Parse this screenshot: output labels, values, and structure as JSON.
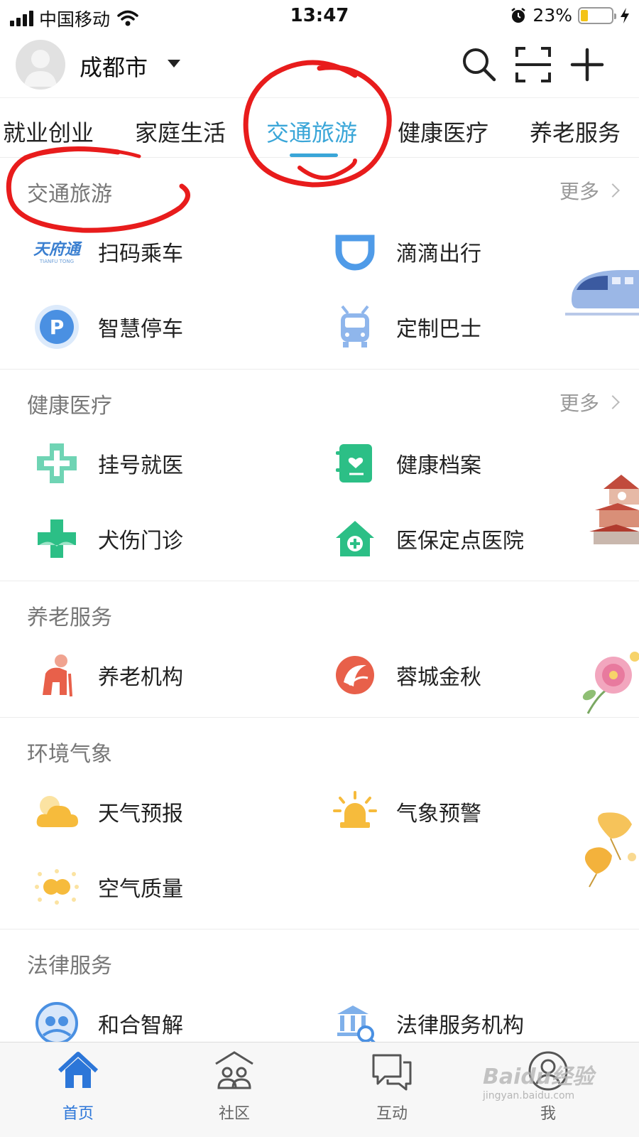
{
  "status_bar": {
    "carrier": "中国移动",
    "time": "13:47",
    "battery": "23%",
    "battery_level": 0.23
  },
  "header": {
    "city": "成都市",
    "icons": [
      "search-icon",
      "scan-icon",
      "plus-icon"
    ]
  },
  "tabs": [
    {
      "label": "就业创业"
    },
    {
      "label": "家庭生活"
    },
    {
      "label": "交通旅游",
      "active": true
    },
    {
      "label": "健康医疗"
    },
    {
      "label": "养老服务"
    }
  ],
  "sections": {
    "transport": {
      "title": "交通旅游",
      "more": "更多",
      "items": [
        {
          "label": "扫码乘车",
          "icon": "tianfutong-logo",
          "logo_text": "天府通",
          "logo_sub": "TIANFU TONG"
        },
        {
          "label": "滴滴出行",
          "icon": "didi-icon"
        },
        {
          "label": "智慧停车",
          "icon": "parking-icon"
        },
        {
          "label": "定制巴士",
          "icon": "bus-icon"
        }
      ]
    },
    "health": {
      "title": "健康医疗",
      "more": "更多",
      "items": [
        {
          "label": "挂号就医",
          "icon": "medical-cross-icon"
        },
        {
          "label": "健康档案",
          "icon": "health-record-icon"
        },
        {
          "label": "犬伤门诊",
          "icon": "clinic-cross-icon"
        },
        {
          "label": "医保定点医院",
          "icon": "hospital-icon"
        }
      ]
    },
    "elderly": {
      "title": "养老服务",
      "items": [
        {
          "label": "养老机构",
          "icon": "elderly-person-icon"
        },
        {
          "label": "蓉城金秋",
          "icon": "golden-autumn-icon"
        }
      ]
    },
    "environment": {
      "title": "环境气象",
      "items": [
        {
          "label": "天气预报",
          "icon": "weather-cloud-icon"
        },
        {
          "label": "气象预警",
          "icon": "warning-light-icon"
        },
        {
          "label": "空气质量",
          "icon": "air-quality-icon"
        }
      ]
    },
    "legal": {
      "title": "法律服务",
      "items": [
        {
          "label": "和合智解",
          "icon": "mediation-icon"
        },
        {
          "label": "法律服务机构",
          "icon": "court-search-icon"
        }
      ]
    }
  },
  "bottom_nav": [
    {
      "label": "首页",
      "icon": "home-icon",
      "active": true
    },
    {
      "label": "社区",
      "icon": "community-icon"
    },
    {
      "label": "互动",
      "icon": "chat-icon"
    },
    {
      "label": "我",
      "icon": "profile-icon"
    }
  ],
  "watermark": {
    "text": "Baidu经验",
    "sub": "jingyan.baidu.com"
  },
  "colors": {
    "accent": "#3aa6d8",
    "annotation_red": "#e81c1c",
    "nav_active": "#2c76d8"
  }
}
